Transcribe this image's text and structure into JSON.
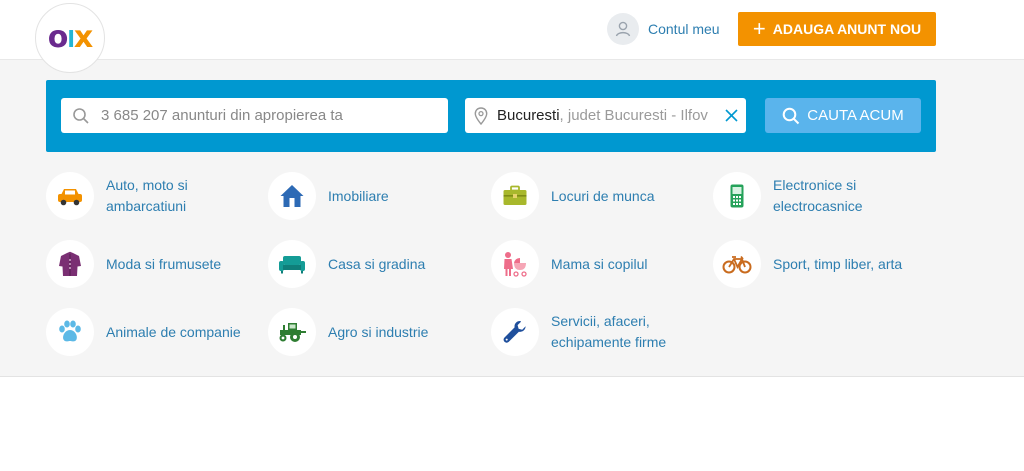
{
  "header": {
    "logo_text": {
      "o": "o",
      "l": "l",
      "x": "x"
    },
    "account_label": "Contul meu",
    "add_button_label": "ADAUGA ANUNT NOU",
    "add_button_icon": "plus-icon"
  },
  "search": {
    "query_placeholder": "3 685 207 anunturi din apropierea ta",
    "query_value": "",
    "location_value": "Bucuresti",
    "location_hint": ", judet Bucuresti - Ilfov",
    "button_label": "CAUTA ACUM"
  },
  "colors": {
    "brand_orange": "#f39200",
    "search_blue": "#0098d0",
    "button_blue": "#5ab4ec",
    "link_blue": "#2d7eb0"
  },
  "categories": [
    {
      "label": "Auto, moto si ambarcatiuni",
      "icon": "car-icon"
    },
    {
      "label": "Imobiliare",
      "icon": "house-icon"
    },
    {
      "label": "Locuri de munca",
      "icon": "briefcase-icon"
    },
    {
      "label": "Electronice si electrocasnice",
      "icon": "phone-icon"
    },
    {
      "label": "Moda si frumusete",
      "icon": "coat-icon"
    },
    {
      "label": "Casa si gradina",
      "icon": "sofa-icon"
    },
    {
      "label": "Mama si copilul",
      "icon": "stroller-icon"
    },
    {
      "label": "Sport, timp liber, arta",
      "icon": "bicycle-icon"
    },
    {
      "label": "Animale de companie",
      "icon": "paw-icon"
    },
    {
      "label": "Agro si industrie",
      "icon": "tractor-icon"
    },
    {
      "label": "Servicii, afaceri, echipamente firme",
      "icon": "wrench-icon"
    }
  ]
}
